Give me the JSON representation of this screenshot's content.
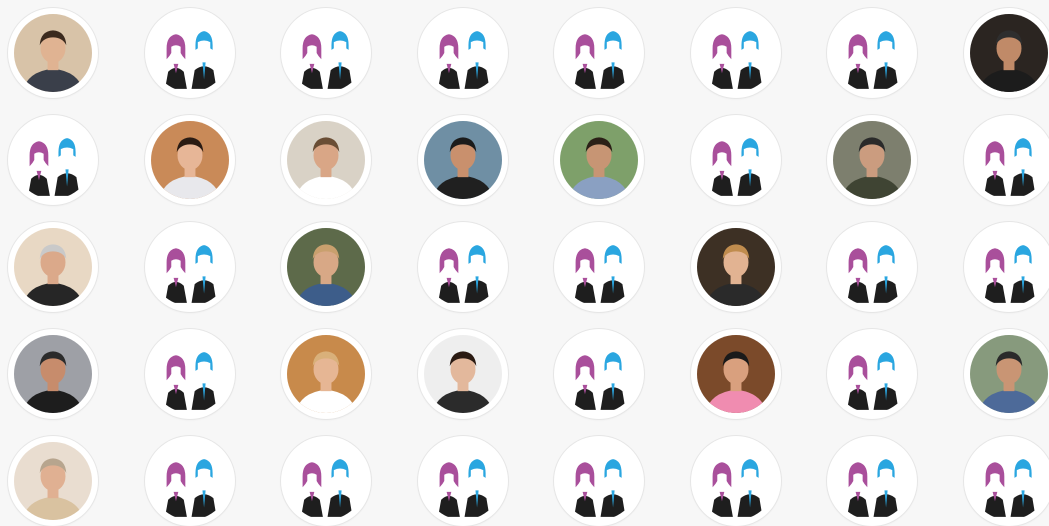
{
  "colors": {
    "page_background": "#f7f7f7",
    "placeholder_female": "#a94f9b",
    "placeholder_male": "#2aa6e0",
    "suit": "#1e1e1e"
  },
  "grid": {
    "rows": [
      [
        "photo",
        "placeholder",
        "placeholder",
        "placeholder",
        "placeholder",
        "placeholder",
        "placeholder",
        "photo"
      ],
      [
        "placeholder",
        "photo",
        "photo",
        "photo",
        "photo",
        "placeholder",
        "photo",
        "placeholder"
      ],
      [
        "photo",
        "placeholder",
        "photo",
        "placeholder",
        "placeholder",
        "photo",
        "placeholder",
        "placeholder"
      ],
      [
        "photo",
        "placeholder",
        "photo",
        "photo",
        "placeholder",
        "photo",
        "placeholder",
        "photo"
      ],
      [
        "photo",
        "placeholder",
        "placeholder",
        "placeholder",
        "placeholder",
        "placeholder",
        "placeholder",
        "placeholder"
      ]
    ],
    "photos": [
      {
        "bg": "#d8c3a8",
        "skin": "#e0b392",
        "hair": "#3b2a1e",
        "shirt": "#3a3f4a"
      },
      {
        "bg": "#2b2521",
        "skin": "#c08a68",
        "hair": "#2e2e2e",
        "shirt": "#1c1c1c"
      },
      {
        "bg": "#c98a58",
        "skin": "#e7b697",
        "hair": "#2a1c14",
        "shirt": "#e8e8ec"
      },
      {
        "bg": "#d9d2c6",
        "skin": "#d9a686",
        "hair": "#6a4e35",
        "shirt": "#ffffff"
      },
      {
        "bg": "#6f8fa4",
        "skin": "#c9906d",
        "hair": "#1b1b1b",
        "shirt": "#202020"
      },
      {
        "bg": "#7ea06a",
        "skin": "#c79574",
        "hair": "#2b2017",
        "shirt": "#8aa0c2"
      },
      {
        "bg": "#7d7f6e",
        "skin": "#cb9c7f",
        "hair": "#2a2a2a",
        "shirt": "#3f4433"
      },
      {
        "bg": "#e8d8c4",
        "skin": "#dba98a",
        "hair": "#c9c9c9",
        "shirt": "#262626"
      },
      {
        "bg": "#5d6a4a",
        "skin": "#d8a886",
        "hair": "#c9a06e",
        "shirt": "#3d5d8a"
      },
      {
        "bg": "#3d3024",
        "skin": "#e2b392",
        "hair": "#c08c4e",
        "shirt": "#2a2a2a"
      },
      {
        "bg": "#9ea0a6",
        "skin": "#c78c6c",
        "hair": "#2b2b2b",
        "shirt": "#1d1d1d"
      },
      {
        "bg": "#c88a4b",
        "skin": "#e6b694",
        "hair": "#d9b07a",
        "shirt": "#ffffff"
      },
      {
        "bg": "#eeeeee",
        "skin": "#e3b89c",
        "hair": "#2a1a12",
        "shirt": "#2b2b2b"
      },
      {
        "bg": "#7b4a2a",
        "skin": "#d9a07e",
        "hair": "#1a1a1a",
        "shirt": "#f08cb0"
      },
      {
        "bg": "#879a7d",
        "skin": "#c99574",
        "hair": "#2a2a2a",
        "shirt": "#4d6a99"
      },
      {
        "bg": "#e9ddd0",
        "skin": "#e0b092",
        "hair": "#b7a58e",
        "shirt": "#d9c2a0"
      }
    ]
  }
}
